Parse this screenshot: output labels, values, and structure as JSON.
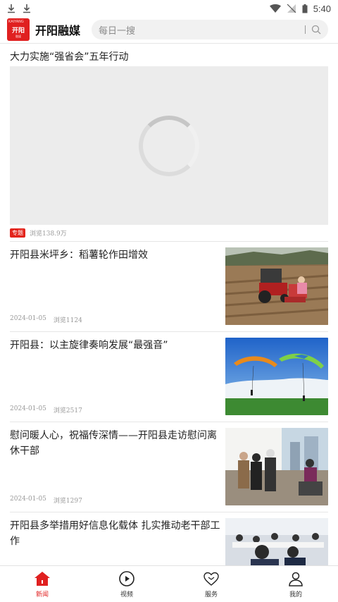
{
  "status_bar": {
    "time": "5:40",
    "left_icons": [
      "download-icon",
      "download-icon"
    ],
    "right_icons": [
      "wifi-icon",
      "signal-off-icon",
      "battery-icon"
    ]
  },
  "header": {
    "logo": {
      "main_text": "开阳",
      "top_text": "KAIYANG",
      "sub_text": "融媒"
    },
    "app_title": "开阳融媒",
    "search_placeholder": "每日一搜"
  },
  "featured": {
    "title": "大力实施“强省会”五年行动",
    "tag": "专题",
    "views": "浏览138.9万",
    "image_state": "loading"
  },
  "news": [
    {
      "title": "开阳县米坪乡：稻薯轮作田增效",
      "date": "2024-01-05",
      "views": "浏览1124",
      "thumb": "farmers-tractor-field"
    },
    {
      "title": "开阳县：以主旋律奏响发展“最强音”",
      "date": "2024-01-05",
      "views": "浏览2517",
      "thumb": "paragliders-over-clouds"
    },
    {
      "title": "慰问暖人心，祝福传深情——开阳县走访慰问离休干部",
      "date": "2024-01-05",
      "views": "浏览1297",
      "thumb": "visit-elderly-home"
    },
    {
      "title": "开阳县多举措用好信息化载体 扎实推动老干部工作",
      "date": "",
      "views": "",
      "thumb": "meeting-room"
    }
  ],
  "bottom_nav": [
    {
      "label": "新闻",
      "icon": "home-icon",
      "active": true
    },
    {
      "label": "视频",
      "icon": "play-circle-icon",
      "active": false
    },
    {
      "label": "服务",
      "icon": "heart-icon",
      "active": false
    },
    {
      "label": "我的",
      "icon": "user-icon",
      "active": false
    }
  ],
  "colors": {
    "accent": "#e02020",
    "tag_bg": "#e3241b",
    "muted_text": "#9a9a9a"
  }
}
